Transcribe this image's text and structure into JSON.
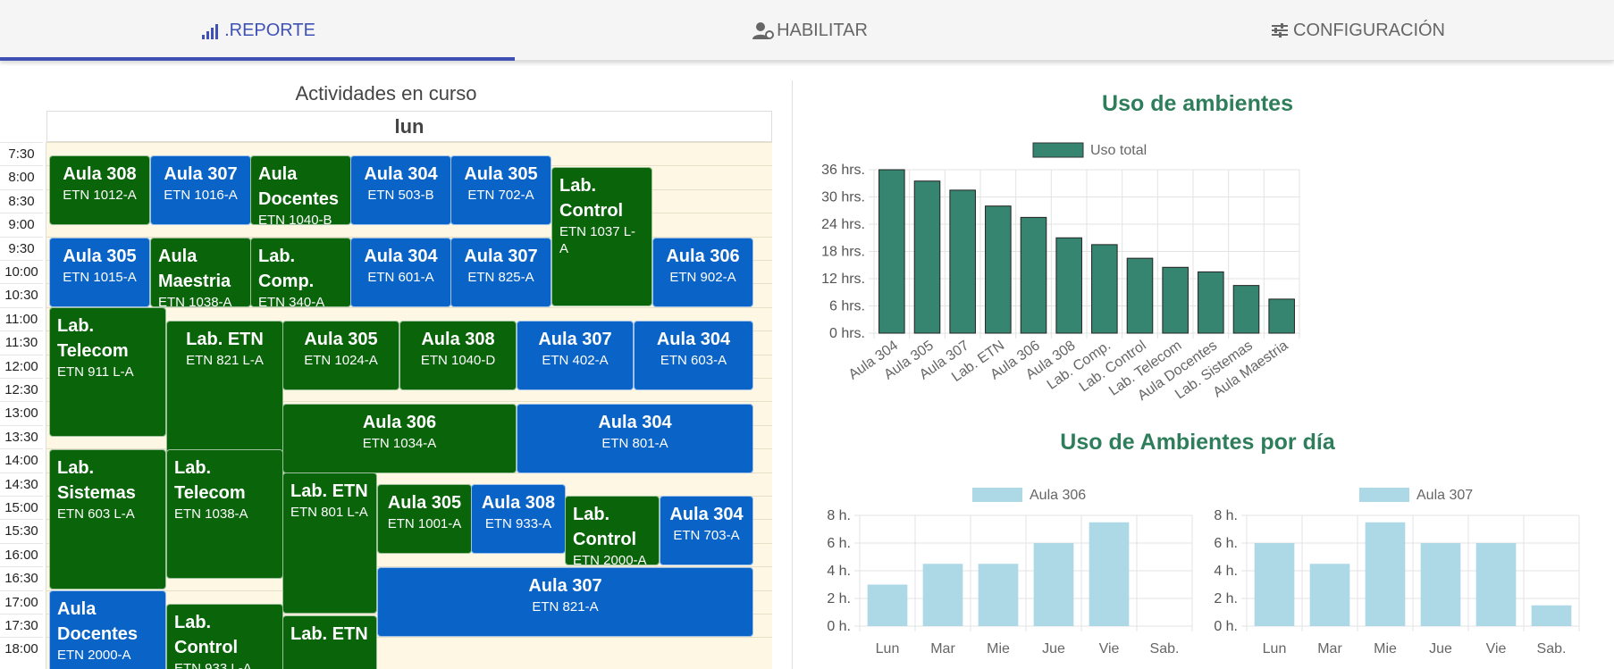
{
  "tabs": [
    {
      "label": ".REPORTE",
      "icon": "signal-bars-icon",
      "active": true
    },
    {
      "label": "HABILITAR",
      "icon": "user-gear-icon",
      "active": false
    },
    {
      "label": "CONFIGURACIÓN",
      "icon": "sliders-icon",
      "active": false
    }
  ],
  "schedule": {
    "title": "Actividades en curso",
    "day": "lun",
    "times": [
      "7:30",
      "8:00",
      "8:30",
      "9:00",
      "9:30",
      "10:00",
      "10:30",
      "11:00",
      "11:30",
      "12:00",
      "12:30",
      "13:00",
      "13:30",
      "14:00",
      "14:30",
      "15:00",
      "15:30",
      "16:00",
      "16:30",
      "17:00",
      "17:30",
      "18:00"
    ],
    "events": [
      {
        "name": "Aula 308",
        "code": "ETN 1012-A",
        "color": "green"
      },
      {
        "name": "Aula 307",
        "code": "ETN 1016-A",
        "color": "blue"
      },
      {
        "name": "Aula Docentes",
        "code": "ETN 1040-B",
        "color": "green"
      },
      {
        "name": "Aula 304",
        "code": "ETN 503-B",
        "color": "blue"
      },
      {
        "name": "Aula 305",
        "code": "ETN 702-A",
        "color": "blue"
      },
      {
        "name": "Lab. Control",
        "code": "ETN 1037 L-A",
        "color": "green"
      },
      {
        "name": "Aula 305",
        "code": "ETN 1015-A",
        "color": "blue"
      },
      {
        "name": "Aula Maestria",
        "code": "ETN 1038-A",
        "color": "green"
      },
      {
        "name": "Lab. Comp.",
        "code": "ETN 340-A",
        "color": "green"
      },
      {
        "name": "Aula 304",
        "code": "ETN 601-A",
        "color": "blue"
      },
      {
        "name": "Aula 307",
        "code": "ETN 825-A",
        "color": "blue"
      },
      {
        "name": "Aula 306",
        "code": "ETN 902-A",
        "color": "blue"
      },
      {
        "name": "Lab. Telecom",
        "code": "ETN 911 L-A",
        "color": "green"
      },
      {
        "name": "Lab. ETN",
        "code": "ETN 821 L-A",
        "color": "green"
      },
      {
        "name": "Aula 305",
        "code": "ETN 1024-A",
        "color": "green"
      },
      {
        "name": "Aula 308",
        "code": "ETN 1040-D",
        "color": "green"
      },
      {
        "name": "Aula 307",
        "code": "ETN 402-A",
        "color": "blue"
      },
      {
        "name": "Aula 304",
        "code": "ETN 603-A",
        "color": "blue"
      },
      {
        "name": "Aula 306",
        "code": "ETN 1034-A",
        "color": "green"
      },
      {
        "name": "Aula 304",
        "code": "ETN 801-A",
        "color": "blue"
      },
      {
        "name": "Lab. Sistemas",
        "code": "ETN 603 L-A",
        "color": "green"
      },
      {
        "name": "Lab. Telecom",
        "code": "ETN 1038-A",
        "color": "green"
      },
      {
        "name": "Lab. ETN",
        "code": "ETN 801 L-A",
        "color": "green"
      },
      {
        "name": "Aula 305",
        "code": "ETN 1001-A",
        "color": "green"
      },
      {
        "name": "Aula 308",
        "code": "ETN 933-A",
        "color": "blue"
      },
      {
        "name": "Lab. Control",
        "code": "ETN 2000-A",
        "color": "green"
      },
      {
        "name": "Aula 304",
        "code": "ETN 703-A",
        "color": "blue"
      },
      {
        "name": "Aula 307",
        "code": "ETN 821-A",
        "color": "blue"
      },
      {
        "name": "Aula Docentes",
        "code": "ETN 2000-A",
        "color": "blue"
      },
      {
        "name": "Lab. Control",
        "code": "ETN 933 L-A",
        "color": "green"
      },
      {
        "name": "Lab. ETN",
        "code": "",
        "color": "green"
      }
    ]
  },
  "charts": {
    "title_usage": "Uso de ambientes",
    "title_daily": "Uso de Ambientes por día"
  },
  "chart_data": [
    {
      "type": "bar",
      "title": "Uso de ambientes",
      "categories": [
        "Aula 304",
        "Aula 305",
        "Aula 307",
        "Lab. ETN",
        "Aula 306",
        "Aula 308",
        "Lab. Comp.",
        "Lab. Control",
        "Lab. Telecom",
        "Aula Docentes",
        "Lab. Sistemas",
        "Aula Maestria"
      ],
      "series": [
        {
          "name": "Uso total",
          "values": [
            36,
            33.5,
            31.5,
            28,
            25.5,
            21,
            19.5,
            16.5,
            14.5,
            13.5,
            10.5,
            7.5
          ]
        }
      ],
      "yticks": [
        "0 hrs.",
        "6 hrs.",
        "12 hrs.",
        "18 hrs.",
        "24 hrs.",
        "30 hrs.",
        "36 hrs."
      ],
      "ylim": [
        0,
        36
      ],
      "grid": true,
      "legend": "top",
      "color": "#358570"
    },
    {
      "type": "bar",
      "categories": [
        "Lun",
        "Mar",
        "Mie",
        "Jue",
        "Vie",
        "Sab."
      ],
      "series": [
        {
          "name": "Aula 306",
          "values": [
            3,
            4.5,
            4.5,
            6,
            7.5,
            0
          ]
        }
      ],
      "yticks": [
        "0 h.",
        "2 h.",
        "4 h.",
        "6 h.",
        "8 h."
      ],
      "ylim": [
        0,
        8
      ],
      "grid": true,
      "legend": "top",
      "color": "#add8e6"
    },
    {
      "type": "bar",
      "categories": [
        "Lun",
        "Mar",
        "Mie",
        "Jue",
        "Vie",
        "Sab."
      ],
      "series": [
        {
          "name": "Aula 307",
          "values": [
            6,
            4.5,
            7.5,
            6,
            6,
            1.5
          ]
        }
      ],
      "yticks": [
        "0 h.",
        "2 h.",
        "4 h.",
        "6 h.",
        "8 h."
      ],
      "ylim": [
        0,
        8
      ],
      "grid": true,
      "legend": "top",
      "color": "#add8e6"
    }
  ]
}
